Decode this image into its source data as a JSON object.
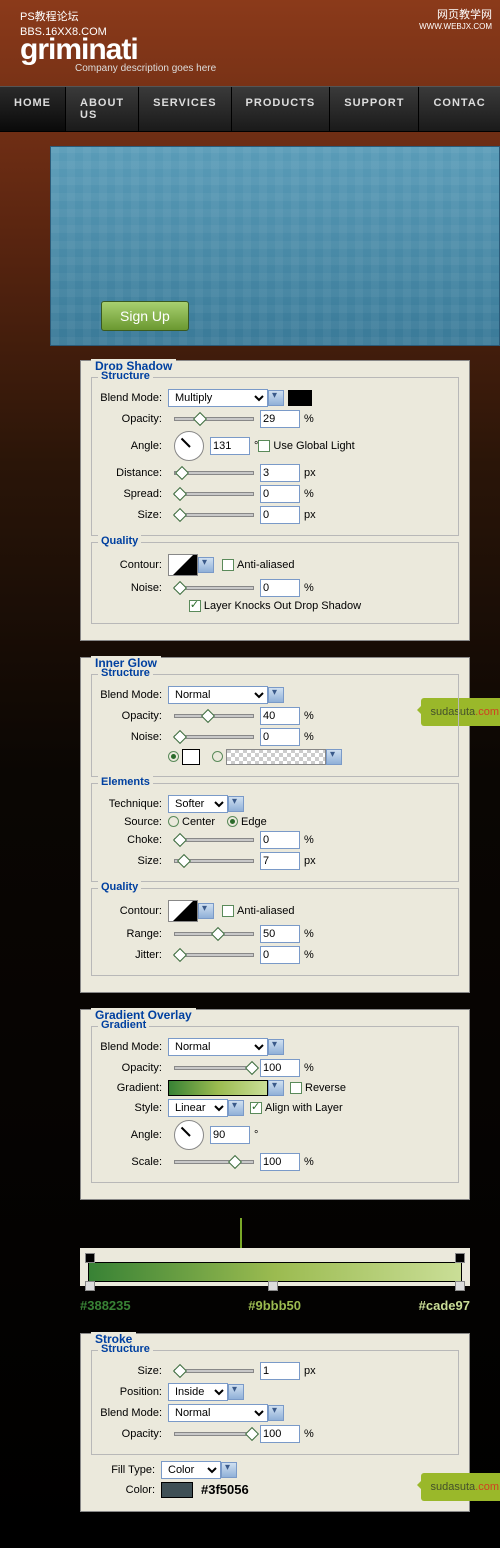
{
  "watermark": {
    "left1": "PS教程论坛",
    "left2": "BBS.16XX8.COM",
    "right1": "网页教学网",
    "right2": "WWW.WEBJX.COM"
  },
  "brand": {
    "logo": "griminati",
    "tagline": "Company description goes here"
  },
  "nav": [
    "HOME",
    "ABOUT US",
    "SERVICES",
    "PRODUCTS",
    "SUPPORT",
    "CONTAC"
  ],
  "hero": {
    "signup": "Sign Up"
  },
  "dropShadow": {
    "title": "Drop Shadow",
    "structure": "Structure",
    "blendModeLabel": "Blend Mode:",
    "blendMode": "Multiply",
    "opacityLabel": "Opacity:",
    "opacity": "29",
    "opacityUnit": "%",
    "angleLabel": "Angle:",
    "angle": "131",
    "angleUnit": "°",
    "useGlobal": "Use Global Light",
    "distanceLabel": "Distance:",
    "distance": "3",
    "distanceUnit": "px",
    "spreadLabel": "Spread:",
    "spread": "0",
    "spreadUnit": "%",
    "sizeLabel": "Size:",
    "size": "0",
    "sizeUnit": "px",
    "quality": "Quality",
    "contourLabel": "Contour:",
    "antiAliased": "Anti-aliased",
    "noiseLabel": "Noise:",
    "noise": "0",
    "noiseUnit": "%",
    "knockout": "Layer Knocks Out Drop Shadow"
  },
  "innerGlow": {
    "title": "Inner Glow",
    "structure": "Structure",
    "blendModeLabel": "Blend Mode:",
    "blendMode": "Normal",
    "opacityLabel": "Opacity:",
    "opacity": "40",
    "opacityUnit": "%",
    "noiseLabel": "Noise:",
    "noise": "0",
    "noiseUnit": "%",
    "elements": "Elements",
    "techniqueLabel": "Technique:",
    "technique": "Softer",
    "sourceLabel": "Source:",
    "center": "Center",
    "edge": "Edge",
    "chokeLabel": "Choke:",
    "choke": "0",
    "chokeUnit": "%",
    "sizeLabel": "Size:",
    "size": "7",
    "sizeUnit": "px",
    "quality": "Quality",
    "contourLabel": "Contour:",
    "antiAliased": "Anti-aliased",
    "rangeLabel": "Range:",
    "range": "50",
    "rangeUnit": "%",
    "jitterLabel": "Jitter:",
    "jitter": "0",
    "jitterUnit": "%"
  },
  "gradientOverlay": {
    "title": "Gradient Overlay",
    "gradient": "Gradient",
    "blendModeLabel": "Blend Mode:",
    "blendMode": "Normal",
    "opacityLabel": "Opacity:",
    "opacity": "100",
    "opacityUnit": "%",
    "gradientLabel": "Gradient:",
    "reverse": "Reverse",
    "styleLabel": "Style:",
    "style": "Linear",
    "align": "Align with Layer",
    "angleLabel": "Angle:",
    "angle": "90",
    "angleUnit": "°",
    "scaleLabel": "Scale:",
    "scale": "100",
    "scaleUnit": "%",
    "stops": [
      "#388235",
      "#9bbb50",
      "#cade97"
    ]
  },
  "stroke": {
    "title": "Stroke",
    "structure": "Structure",
    "sizeLabel": "Size:",
    "size": "1",
    "sizeUnit": "px",
    "positionLabel": "Position:",
    "position": "Inside",
    "blendModeLabel": "Blend Mode:",
    "blendMode": "Normal",
    "opacityLabel": "Opacity:",
    "opacity": "100",
    "opacityUnit": "%",
    "fillTypeLabel": "Fill Type:",
    "fillType": "Color",
    "colorLabel": "Color:",
    "colorHex": "#3f5056"
  },
  "callout": {
    "name": "sudasuta",
    "dc": ".com"
  }
}
